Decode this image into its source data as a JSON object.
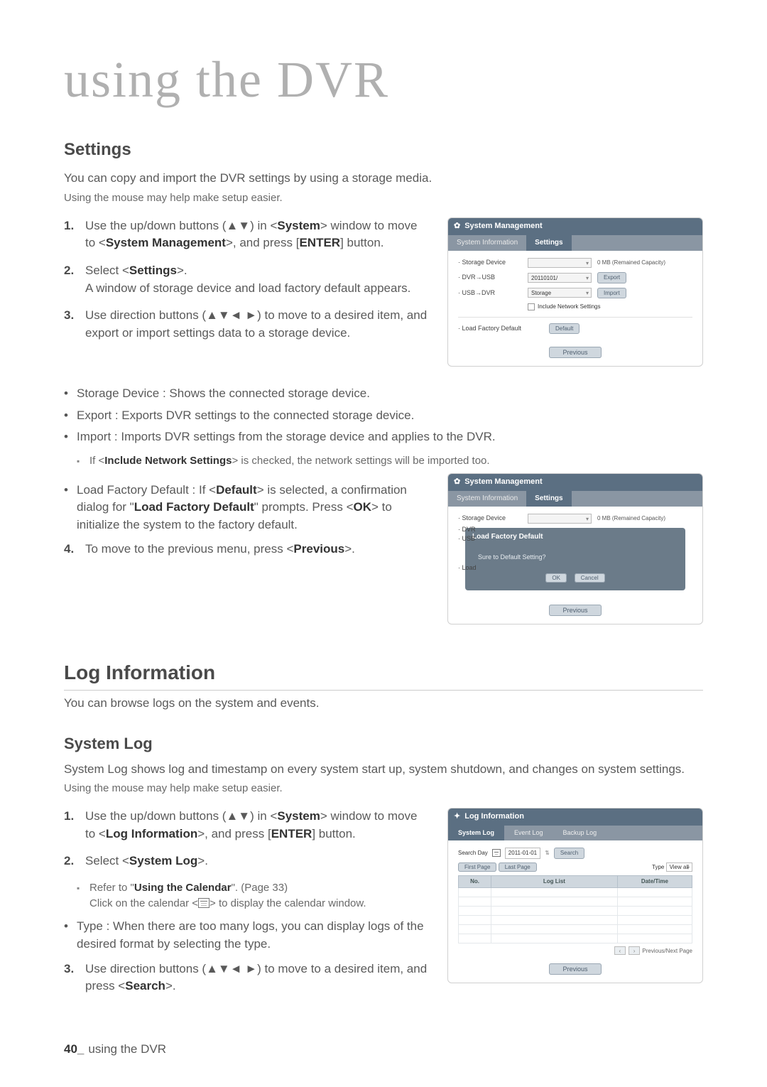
{
  "chapter": "using the DVR",
  "settings": {
    "title": "Settings",
    "intro": "You can copy and import the DVR settings by using a storage media.",
    "note": "Using the mouse may help make setup easier.",
    "steps": {
      "s1_a": "Use the up/down buttons (▲▼) in <",
      "s1_sys": "System",
      "s1_b": "> window to move to <",
      "s1_sm": "System Management",
      "s1_c": ">, and press [",
      "s1_enter": "ENTER",
      "s1_d": "] button.",
      "s2_a": "Select <",
      "s2_set": "Settings",
      "s2_b": ">.",
      "s2_desc": "A window of storage device and load factory default appears.",
      "s3": "Use direction buttons (▲▼◄ ►) to move to a desired item, and export or import settings data to a storage device."
    },
    "bullets": {
      "b1": "Storage Device : Shows the connected storage device.",
      "b2": "Export : Exports DVR settings to the connected storage device.",
      "b3": "Import : Imports DVR settings from the storage device and applies to the DVR.",
      "b3_note_a": "If <",
      "b3_note_b": "Include Network Settings",
      "b3_note_c": "> is checked, the network settings will be imported too.",
      "b4_a": "Load Factory Default : If <",
      "b4_def": "Default",
      "b4_b": "> is selected, a confirmation dialog for \"",
      "b4_lfd": "Load Factory Default",
      "b4_c": "\" prompts. Press <",
      "b4_ok": "OK",
      "b4_d": "> to initialize the system to the factory default."
    },
    "step4_a": "To move to the previous menu, press <",
    "step4_prev": "Previous",
    "step4_b": ">."
  },
  "shot1": {
    "title": "System Management",
    "tab1": "System Information",
    "tab2": "Settings",
    "storage": "· Storage Device",
    "dvrusb": "· DVR→USB",
    "usbdvr": "· USB→DVR",
    "dd_date": "20110101/",
    "dd_storage": "Storage",
    "btn_export": "Export",
    "btn_import": "Import",
    "cap": "0 MB (Remained Capacity)",
    "chk": "Include Network Settings",
    "lfd": "· Load Factory Default",
    "btn_default": "Default",
    "prev": "Previous"
  },
  "shot2": {
    "title": "System Management",
    "tab1": "System Information",
    "tab2": "Settings",
    "storage": "· Storage Device",
    "dvr": "· DVR",
    "usb": "· USB",
    "load": "· Load",
    "cap": "0 MB (Remained Capacity)",
    "mtitle": "Load Factory Default",
    "mtext": "Sure to Default Setting?",
    "ok": "OK",
    "cancel": "Cancel",
    "prev": "Previous"
  },
  "loginfo": {
    "title": "Log Information",
    "intro": "You can browse logs on the system and events."
  },
  "syslog": {
    "title": "System Log",
    "intro": "System Log shows log and timestamp on every system start up, system shutdown, and changes on system settings.",
    "note": "Using the mouse may help make setup easier.",
    "s1_a": "Use the up/down buttons (▲▼) in <",
    "s1_sys": "System",
    "s1_b": "> window to move to <",
    "s1_li": "Log Information",
    "s1_c": ">, and press [",
    "s1_enter": "ENTER",
    "s1_d": "] button.",
    "s2_a": "Select <",
    "s2_sl": "System Log",
    "s2_b": ">.",
    "s2_note1_a": "Refer to \"",
    "s2_note1_b": "Using the Calendar",
    "s2_note1_c": "\". (Page 33)",
    "s2_note2_a": "Click on the calendar <",
    "s2_note2_b": "> to display the calendar window.",
    "b_type": "Type : When there are too many logs, you can display logs of the desired format by selecting the type.",
    "s3_a": "Use direction buttons (▲▼◄ ►) to move to a desired item, and press <",
    "s3_search": "Search",
    "s3_b": ">."
  },
  "shot3": {
    "title": "Log Information",
    "tab1": "System Log",
    "tab2": "Event Log",
    "tab3": "Backup Log",
    "searchday": "Search Day",
    "date": "2011-01-01",
    "search": "Search",
    "first": "First Page",
    "last": "Last Page",
    "type": "Type",
    "viewall": "View all",
    "col_no": "No.",
    "col_list": "Log List",
    "col_dt": "Date/Time",
    "pager": "Previous/Next Page",
    "prev": "Previous"
  },
  "footer": {
    "num": "40_",
    "text": "using the DVR"
  },
  "nums": {
    "n1": "1.",
    "n2": "2.",
    "n3": "3.",
    "n4": "4."
  }
}
